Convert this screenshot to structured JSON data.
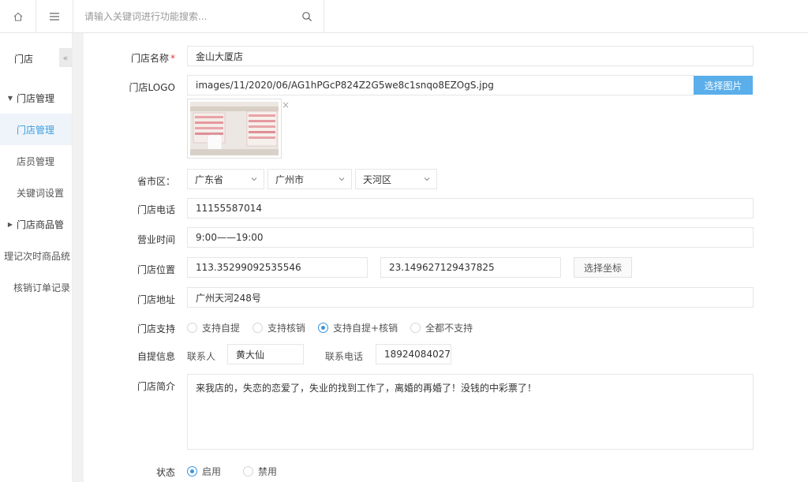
{
  "topbar": {
    "search_placeholder": "请输入关键词进行功能搜索..."
  },
  "sidebar": {
    "title": "门店",
    "collapse_glyph": "«",
    "items": [
      {
        "label": "门店管理",
        "type": "group"
      },
      {
        "label": "门店管理",
        "type": "sub",
        "active": true
      },
      {
        "label": "店员管理",
        "type": "sub"
      },
      {
        "label": "关键词设置",
        "type": "sub"
      },
      {
        "label": "门店商品管",
        "type": "group"
      },
      {
        "label": "理记次时商品统",
        "type": "overflow"
      },
      {
        "label": "核销订单记录",
        "type": "sub"
      }
    ]
  },
  "form": {
    "store_name": {
      "label": "门店名称",
      "required_mark": "*",
      "value": "金山大厦店"
    },
    "logo": {
      "label": "门店LOGO",
      "value": "images/11/2020/06/AG1hPGcP824Z2G5we8c1snqo8EZOgS.jpg",
      "button": "选择图片",
      "remove": "×"
    },
    "region": {
      "label": "省市区：",
      "province": "广东省",
      "city": "广州市",
      "district": "天河区"
    },
    "phone": {
      "label": "门店电话",
      "value": "11155587014"
    },
    "hours": {
      "label": "营业时间",
      "value": "9:00——19:00"
    },
    "location": {
      "label": "门店位置",
      "lng": "113.35299092535546",
      "lat": "23.149627129437825",
      "button": "选择坐标"
    },
    "address": {
      "label": "门店地址",
      "value": "广州天河248号"
    },
    "support": {
      "label": "门店支持",
      "options": [
        {
          "label": "支持自提",
          "checked": false
        },
        {
          "label": "支持核销",
          "checked": false
        },
        {
          "label": "支持自提+核销",
          "checked": true
        },
        {
          "label": "全都不支持",
          "checked": false
        }
      ]
    },
    "pickup": {
      "label": "自提信息",
      "contact_label": "联系人",
      "contact_value": "黄大仙",
      "phone_label": "联系电话",
      "phone_value": "18924084027"
    },
    "intro": {
      "label": "门店简介",
      "value": "来我店的，失恋的恋爱了，失业的找到工作了，离婚的再婚了！没钱的中彩票了！"
    },
    "status": {
      "label": "状态",
      "options": [
        {
          "label": "启用",
          "checked": true
        },
        {
          "label": "禁用",
          "checked": false
        }
      ]
    }
  },
  "colors": {
    "accent": "#3a94dd",
    "primary_button": "#5aaeea",
    "required": "#e4393c",
    "active_bg": "#eef4f9"
  }
}
